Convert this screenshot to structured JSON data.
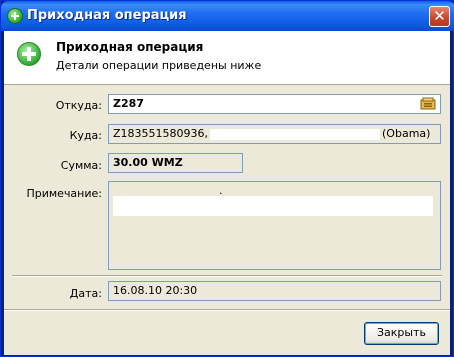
{
  "window": {
    "title": "Приходная операция",
    "close_glyph": "✕"
  },
  "header": {
    "title": "Приходная операция",
    "subtitle": "Детали операции приведены ниже",
    "icon": "plus-circle-icon"
  },
  "form": {
    "from_label": "Откуда:",
    "from_value": "Z287",
    "to_label": "Куда:",
    "to_value_start": "Z183551580936,",
    "to_value_end": "(Obama)",
    "amount_label": "Сумма:",
    "amount_value": "30.00 WMZ",
    "note_label": "Примечание:",
    "note_value": ".",
    "date_label": "Дата:",
    "date_value": "16.08.10 20:30"
  },
  "buttons": {
    "close_label": "Закрыть"
  },
  "colors": {
    "title_bar": "#0c57df",
    "dialog_bg": "#ece9d8",
    "field_border": "#7f9db9"
  }
}
